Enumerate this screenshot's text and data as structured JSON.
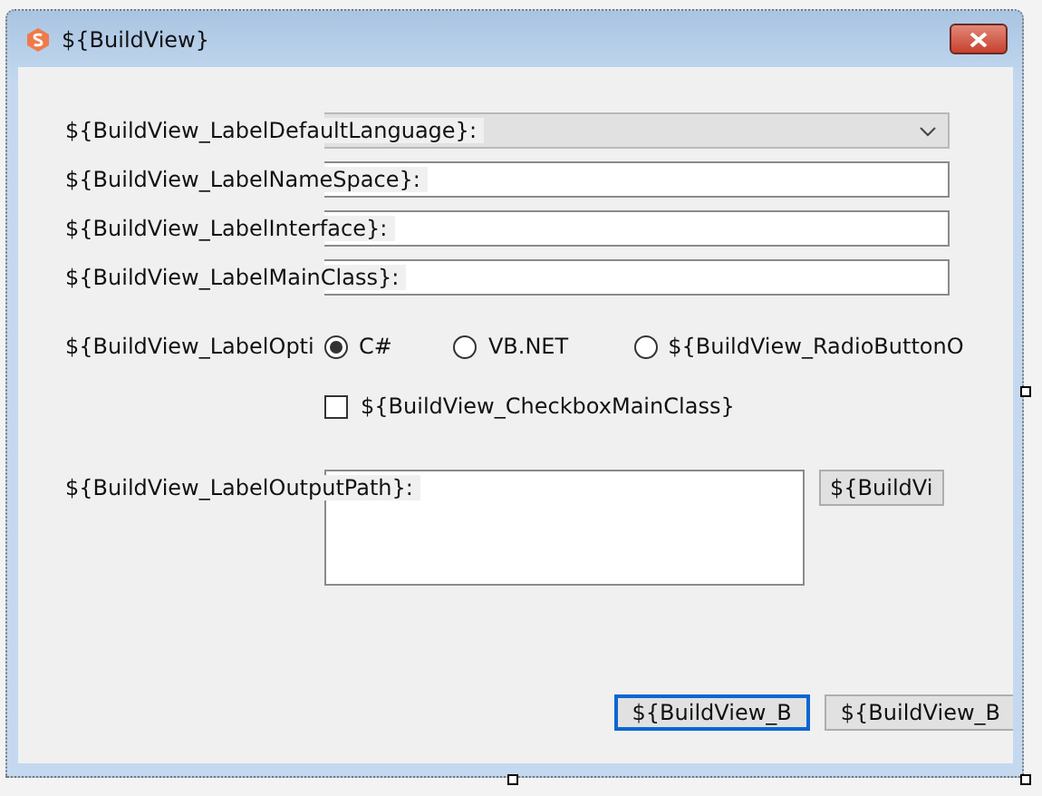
{
  "window": {
    "title": "${BuildView}"
  },
  "fields": [
    {
      "kind": "combo",
      "label": "${BuildView_LabelDefaultLanguage}:"
    },
    {
      "kind": "text",
      "label": "${BuildView_LabelNameSpace}:"
    },
    {
      "kind": "text",
      "label": "${BuildView_LabelInterface}:"
    },
    {
      "kind": "text",
      "label": "${BuildView_LabelMainClass}:"
    }
  ],
  "options": {
    "label": "${BuildView_LabelOpti",
    "radios": [
      {
        "label": "C#",
        "selected": true
      },
      {
        "label": "VB.NET",
        "selected": false
      },
      {
        "label": "${BuildView_RadioButtonO",
        "selected": false
      }
    ]
  },
  "checkbox": {
    "label": "${BuildView_CheckboxMainClass}",
    "checked": false
  },
  "output": {
    "label": "${BuildView_LabelOutputPath}:",
    "button": "${BuildVi"
  },
  "buttons": [
    {
      "label": "${BuildView_B",
      "focused": true
    },
    {
      "label": "${BuildView_B",
      "focused": false
    }
  ]
}
